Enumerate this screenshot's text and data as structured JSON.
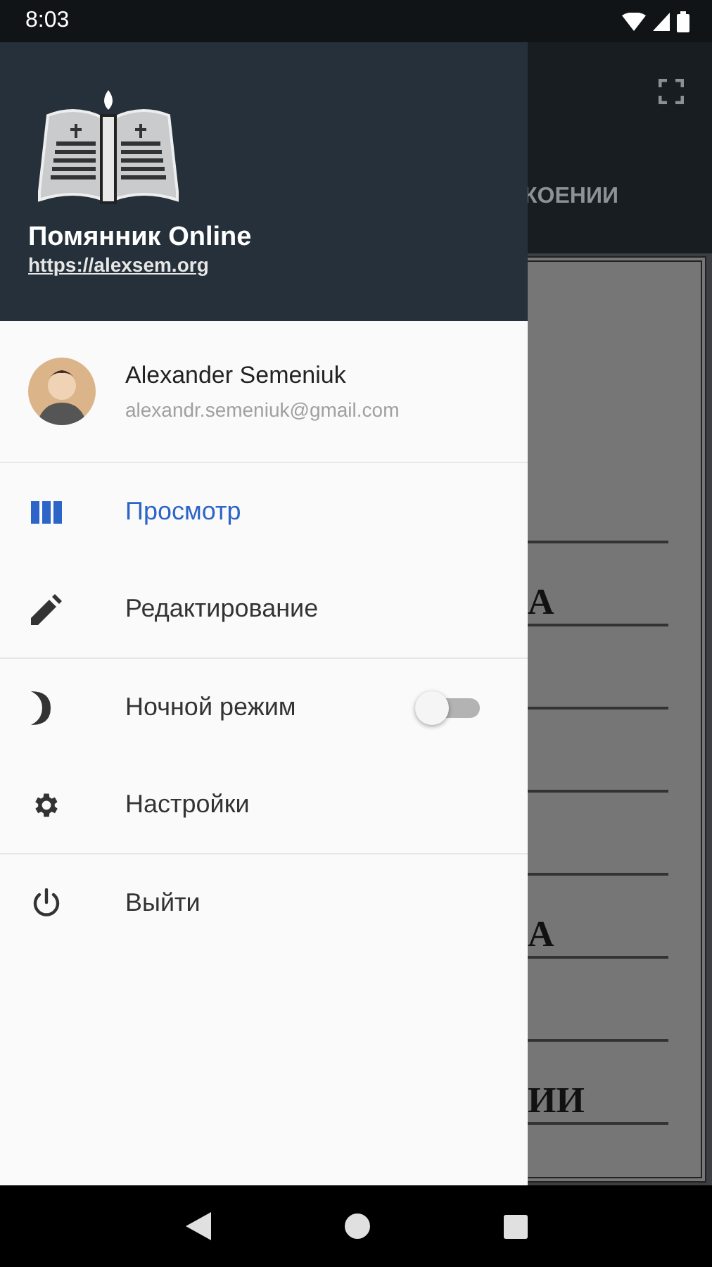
{
  "status_bar": {
    "time": "8:03"
  },
  "background": {
    "tab": "КОЕНИИ",
    "rows": [
      {},
      {
        "text": "А"
      },
      {},
      {},
      {},
      {
        "text": "А"
      },
      {},
      {
        "text": "ИИ"
      }
    ]
  },
  "drawer": {
    "title": "Помянник Online",
    "link": "https://alexsem.org",
    "account": {
      "name": "Alexander Semeniuk",
      "email": "alexandr.semeniuk@gmail.com"
    },
    "groups": [
      [
        {
          "kind": "nav",
          "label": "Просмотр",
          "selected": true
        },
        {
          "kind": "nav",
          "label": "Редактирование",
          "selected": false
        }
      ],
      [
        {
          "kind": "toggle",
          "label": "Ночной режим",
          "on": false
        },
        {
          "kind": "nav",
          "label": "Настройки",
          "selected": false
        }
      ],
      [
        {
          "kind": "nav",
          "label": "Выйти",
          "selected": false
        }
      ]
    ]
  }
}
